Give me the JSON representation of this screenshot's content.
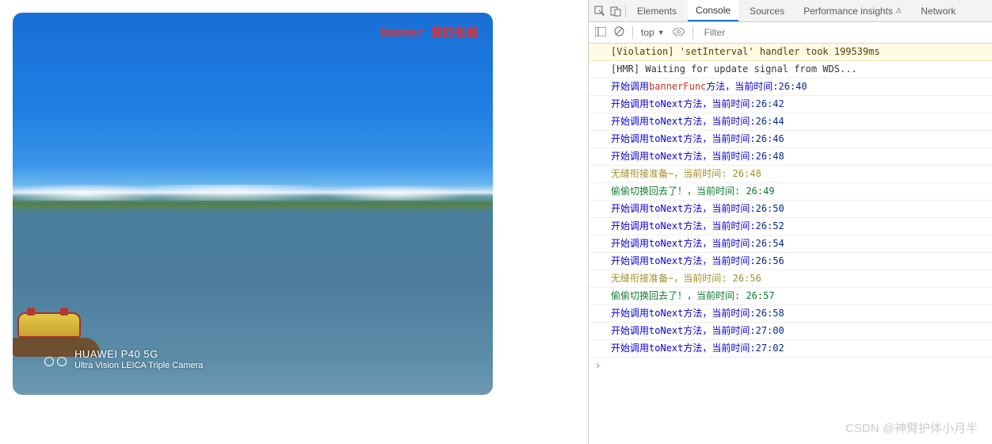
{
  "banner": {
    "overlay": "banner 第四张图",
    "watermark_line1": "HUAWEI P40 5G",
    "watermark_line2": "Ultra Vision LEICA Triple Camera"
  },
  "devtools": {
    "tabs": [
      "Elements",
      "Console",
      "Sources",
      "Performance insights",
      "Network"
    ],
    "active_tab": "Console",
    "insights_badge": "⚠",
    "toolbar": {
      "scope": "top",
      "filter_placeholder": "Filter"
    }
  },
  "console_logs": [
    {
      "kind": "violation",
      "text": "[Violation] 'setInterval' handler took 199539ms"
    },
    {
      "kind": "info",
      "text": "[HMR] Waiting for update signal from WDS..."
    },
    {
      "kind": "call",
      "color": "red",
      "prefix": "开始调用 ",
      "name": "bannerFunc",
      "mid": " 方法，当前时间: ",
      "time": "26:40"
    },
    {
      "kind": "call",
      "color": "blue",
      "prefix": "开始调用 ",
      "name": "toNext",
      "mid": " 方法，当前时间: ",
      "time": "26:42"
    },
    {
      "kind": "call",
      "color": "blue",
      "prefix": "开始调用 ",
      "name": "toNext",
      "mid": " 方法，当前时间: ",
      "time": "26:44"
    },
    {
      "kind": "call",
      "color": "blue",
      "prefix": "开始调用 ",
      "name": "toNext",
      "mid": " 方法，当前时间: ",
      "time": "26:46"
    },
    {
      "kind": "call",
      "color": "blue",
      "prefix": "开始调用 ",
      "name": "toNext",
      "mid": " 方法，当前时间: ",
      "time": "26:48"
    },
    {
      "kind": "plain",
      "cls": "yellow",
      "text": "无缝衔接准备~，当前时间: 26:48"
    },
    {
      "kind": "plain",
      "cls": "green",
      "text": "偷偷切换回去了！，当前时间: 26:49"
    },
    {
      "kind": "call",
      "color": "blue",
      "prefix": "开始调用 ",
      "name": "toNext",
      "mid": " 方法，当前时间: ",
      "time": "26:50"
    },
    {
      "kind": "call",
      "color": "blue",
      "prefix": "开始调用 ",
      "name": "toNext",
      "mid": " 方法，当前时间: ",
      "time": "26:52"
    },
    {
      "kind": "call",
      "color": "blue",
      "prefix": "开始调用 ",
      "name": "toNext",
      "mid": " 方法，当前时间: ",
      "time": "26:54"
    },
    {
      "kind": "call",
      "color": "blue",
      "prefix": "开始调用 ",
      "name": "toNext",
      "mid": " 方法，当前时间: ",
      "time": "26:56"
    },
    {
      "kind": "plain",
      "cls": "yellow",
      "text": "无缝衔接准备~，当前时间: 26:56"
    },
    {
      "kind": "plain",
      "cls": "green",
      "text": "偷偷切换回去了！，当前时间: 26:57"
    },
    {
      "kind": "call",
      "color": "blue",
      "prefix": "开始调用 ",
      "name": "toNext",
      "mid": " 方法，当前时间: ",
      "time": "26:58"
    },
    {
      "kind": "call",
      "color": "blue",
      "prefix": "开始调用 ",
      "name": "toNext",
      "mid": " 方法，当前时间: ",
      "time": "27:00"
    },
    {
      "kind": "call",
      "color": "blue",
      "prefix": "开始调用 ",
      "name": "toNext",
      "mid": " 方法，当前时间: ",
      "time": "27:02"
    }
  ],
  "csdn_watermark": "CSDN @神臂护体小月半"
}
